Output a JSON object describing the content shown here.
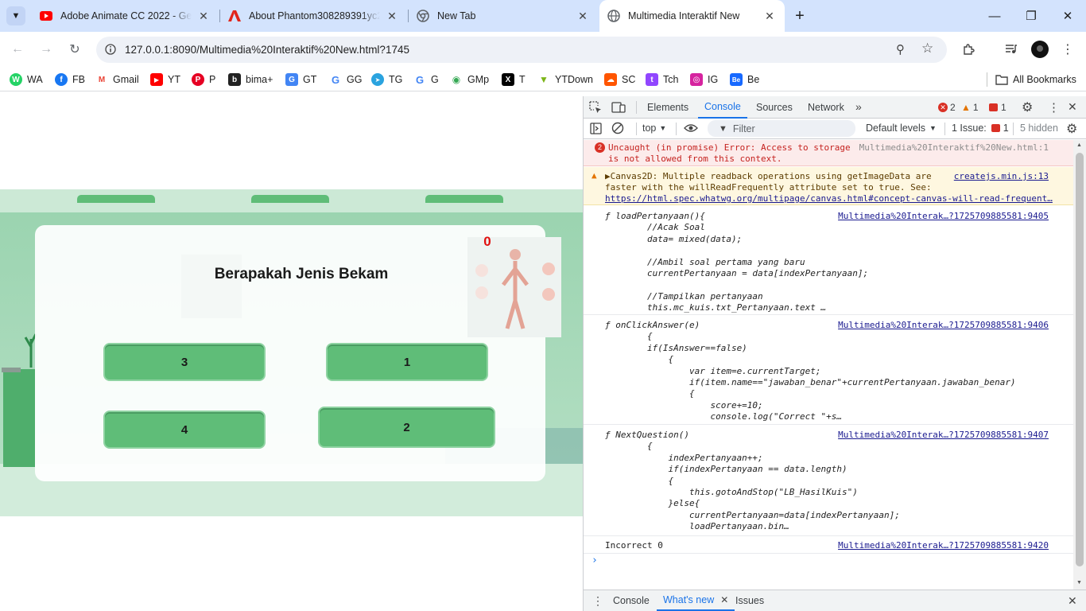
{
  "tabs": [
    {
      "title": "Adobe Animate CC 2022 - Gen",
      "icon": "youtube-icon"
    },
    {
      "title": "About Phantom308289391yc2",
      "icon": "adobe-icon"
    },
    {
      "title": "New Tab",
      "icon": "chrome-icon"
    },
    {
      "title": "Multimedia Interaktif New",
      "icon": "globe-icon"
    }
  ],
  "address": {
    "url": "127.0.0.1:8090/Multimedia%20Interaktif%20New.html?1745"
  },
  "bookmarks": [
    {
      "label": "WA",
      "color": "#25d366",
      "glyph": "W"
    },
    {
      "label": "FB",
      "color": "#1877f2",
      "glyph": "f"
    },
    {
      "label": "Gmail",
      "color": "#ea4335",
      "glyph": "M"
    },
    {
      "label": "YT",
      "color": "#ff0000",
      "glyph": "▶"
    },
    {
      "label": "P",
      "color": "#e60023",
      "glyph": "P"
    },
    {
      "label": "bima+",
      "color": "#222222",
      "glyph": "b"
    },
    {
      "label": "GT",
      "color": "#4285f4",
      "glyph": "G"
    },
    {
      "label": "GG",
      "color": "#4285f4",
      "glyph": "G"
    },
    {
      "label": "TG",
      "color": "#2aa3df",
      "glyph": "➤"
    },
    {
      "label": "G",
      "color": "#4285f4",
      "glyph": "G"
    },
    {
      "label": "GMp",
      "color": "#34a853",
      "glyph": "◉"
    },
    {
      "label": "T",
      "color": "#000000",
      "glyph": "X"
    },
    {
      "label": "YTDown",
      "color": "#7cb518",
      "glyph": "▼"
    },
    {
      "label": "SC",
      "color": "#ff5500",
      "glyph": "☁"
    },
    {
      "label": "Tch",
      "color": "#9146ff",
      "glyph": "t"
    },
    {
      "label": "IG",
      "color": "#d6249f",
      "glyph": "◎"
    },
    {
      "label": "Be",
      "color": "#1769ff",
      "glyph": "Be"
    }
  ],
  "all_bookmarks": "All Bookmarks",
  "quiz": {
    "score": "0",
    "question": "Berapakah Jenis Bekam",
    "answers": [
      "3",
      "1",
      "4",
      "2"
    ]
  },
  "devtools": {
    "tabs": [
      "Elements",
      "Console",
      "Sources",
      "Network"
    ],
    "errors": "2",
    "warnings": "1",
    "issues_badge": "1",
    "context": "top",
    "filter_placeholder": "Filter",
    "levels": "Default levels",
    "issues_label": "1 Issue:",
    "issues_count": "1",
    "hidden": "5 hidden",
    "error_count": "2",
    "error_msg_1": "Uncaught (in promise) Error: Access to storage",
    "error_msg_2": "is not allowed from this context.",
    "error_src": "Multimedia%20Interaktif%20New.html:1",
    "warn_msg_1": "▶Canvas2D: Multiple readback operations using getImageData are",
    "warn_msg_2": "faster with the willReadFrequently attribute set to true. See:",
    "warn_link": "https://html.spec.whatwg.org/multipage/canvas.html#concept-canvas-will-read-frequent…",
    "warn_src": "createjs.min.js:13",
    "fn1_src": "Multimedia%20Interak…?1725709885581:9405",
    "fn1_code": "ƒ loadPertanyaan(){\n        //Acak Soal\n        data= mixed(data);\n\n        //Ambil soal pertama yang baru\n        currentPertanyaan = data[indexPertanyaan];\n\n        //Tampilkan pertanyaan\n        this.mc_kuis.txt_Pertanyaan.text …",
    "fn2_src": "Multimedia%20Interak…?1725709885581:9406",
    "fn2_code": "ƒ onClickAnswer(e)\n        {\n        if(IsAnswer==false)\n            {\n                var item=e.currentTarget;\n                if(item.name==\"jawaban_benar\"+currentPertanyaan.jawaban_benar)\n                {\n                    score+=10;\n                    console.log(\"Correct \"+s…",
    "fn3_src": "Multimedia%20Interak…?1725709885581:9407",
    "fn3_code": "ƒ NextQuestion()\n        {\n            indexPertanyaan++;\n            if(indexPertanyaan == data.length)\n            {\n                this.gotoAndStop(\"LB_HasilKuis\")\n            }else{\n                currentPertanyaan=data[indexPertanyaan];\n                loadPertanyaan.bin…",
    "log_text": "Incorrect 0",
    "log_src": "Multimedia%20Interak…?1725709885581:9420",
    "prompt": "›",
    "drawer_tabs": [
      "Console",
      "What's new",
      "Issues"
    ]
  }
}
